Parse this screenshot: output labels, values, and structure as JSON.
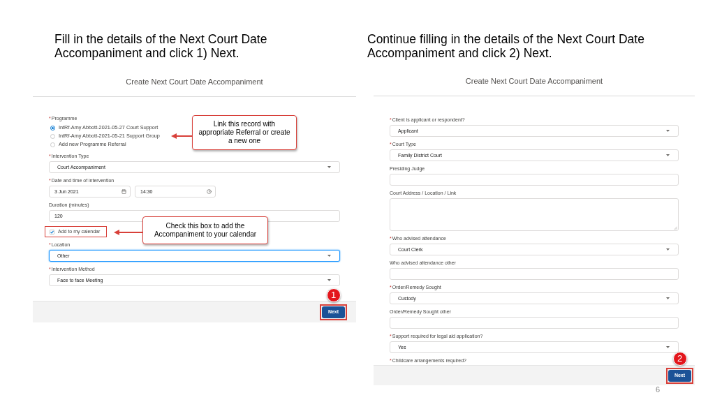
{
  "panels": [
    {
      "instruction": "Fill in the details of the Next Court Date Accompaniment and click 1) Next.",
      "title": "Create Next Court Date Accompaniment",
      "fields": [
        {
          "kind": "radio_group",
          "required_marker": "*",
          "label": "Programme",
          "options": [
            {
              "label": "IntRf-Amy Abbott-2021-05-27 Court Support",
              "selected": true
            },
            {
              "label": "IntRf-Amy Abbott-2021-05-21 Support Group",
              "selected": false
            },
            {
              "label": "Add new Programme Referral",
              "selected": false
            }
          ],
          "callout": "Link this record with appropriate Referral or create a new one"
        },
        {
          "kind": "select",
          "required_marker": "*",
          "label": "Intervention Type",
          "value": "Court Accompaniment",
          "focused": false
        },
        {
          "kind": "datetime",
          "required_marker": "*",
          "label": "Date and time of intervention",
          "date": "3 Jun 2021",
          "time": "14:30"
        },
        {
          "kind": "text",
          "label": "Duration (minutes)",
          "value": "120"
        },
        {
          "kind": "checkbox",
          "label": "Add to my calendar",
          "checked": true,
          "highlighted": true,
          "callout": "Check this box to add the Accompaniment to your calendar"
        },
        {
          "kind": "select",
          "required_marker": "*",
          "label": "Location",
          "value": "Other",
          "focused": true
        },
        {
          "kind": "select",
          "required_marker": "*",
          "label": "Intervention Method",
          "value": "Face to face Meeting",
          "focused": false
        }
      ],
      "next_button": {
        "label": "Next",
        "highlighted": true,
        "step": "1"
      }
    },
    {
      "instruction": "Continue filling in the details of the Next Court Date Accompaniment and click 2) Next.",
      "title": "Create Next Court Date Accompaniment",
      "fields": [
        {
          "kind": "select",
          "required_marker": "*",
          "label": "Client is applicant or respondent?",
          "value": "Applicant",
          "focused": false
        },
        {
          "kind": "select",
          "required_marker": "*",
          "label": "Court Type",
          "value": "Family District Court",
          "focused": false
        },
        {
          "kind": "text",
          "label": "Presiding Judge"
        },
        {
          "kind": "textarea",
          "label": "Court Address / Location / Link"
        },
        {
          "kind": "select",
          "required_marker": "*",
          "label": "Who advised attendance",
          "value": "Court Clerk",
          "focused": false
        },
        {
          "kind": "text",
          "label": "Who advised attendance other"
        },
        {
          "kind": "select",
          "required_marker": "*",
          "label": "Order/Remedy Sought",
          "value": "Custody",
          "focused": false
        },
        {
          "kind": "text",
          "label": "Order/Remedy Sought other"
        },
        {
          "kind": "select",
          "required_marker": "*",
          "label": "Support required for legal aid application?",
          "value": "Yes",
          "focused": false
        },
        {
          "kind": "label_only",
          "required_marker": "*",
          "label": "Childcare arrangements required?"
        }
      ],
      "next_button": {
        "label": "Next",
        "highlighted": true,
        "step": "2"
      }
    }
  ],
  "page_number": "6"
}
